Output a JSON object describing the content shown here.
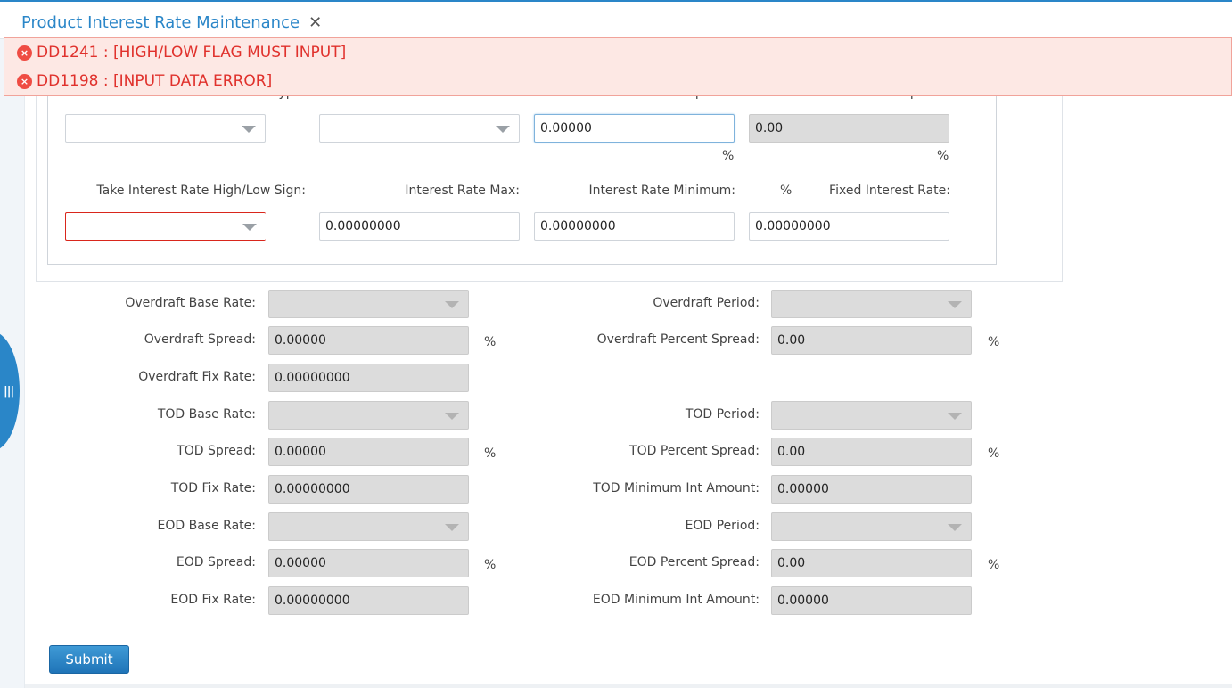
{
  "tab": {
    "title": "Product Interest Rate Maintenance",
    "close": "✕"
  },
  "errors": [
    {
      "text": "DD1241 : [HIGH/LOW FLAG MUST INPUT]"
    },
    {
      "text": "DD1198 : [INPUT DATA ERROR]"
    }
  ],
  "rate_section": {
    "labels_row1": [
      "Interest Rate Type:",
      "Term:",
      "Unit Spread:",
      "Percent Spread:"
    ],
    "row1": {
      "interest_rate_type": "",
      "term": "",
      "unit_spread": "0.00000",
      "percent_spread": "0.00"
    },
    "pct": "%",
    "labels_row2": {
      "high_low_sign": "Take Interest Rate High/Low Sign:",
      "rate_max": "Interest Rate Max:",
      "rate_min": "Interest Rate Minimum:",
      "pct": "%",
      "fixed_rate": "Fixed Interest Rate:"
    },
    "row2": {
      "high_low_sign": "",
      "rate_max": "0.00000000",
      "rate_min": "0.00000000",
      "fixed_rate": "0.00000000"
    }
  },
  "overdraft": {
    "base_rate_label": "Overdraft Base Rate:",
    "period_label": "Overdraft Period:",
    "spread_label": "Overdraft Spread:",
    "spread": "0.00000",
    "percent_spread_label": "Overdraft Percent Spread:",
    "percent_spread": "0.00",
    "fix_rate_label": "Overdraft Fix Rate:",
    "fix_rate": "0.00000000"
  },
  "tod": {
    "base_rate_label": "TOD Base Rate:",
    "period_label": "TOD Period:",
    "spread_label": "TOD Spread:",
    "spread": "0.00000",
    "percent_spread_label": "TOD Percent Spread:",
    "percent_spread": "0.00",
    "fix_rate_label": "TOD Fix Rate:",
    "fix_rate": "0.00000000",
    "min_int_label": "TOD Minimum Int Amount:",
    "min_int": "0.00000"
  },
  "eod": {
    "base_rate_label": "EOD Base Rate:",
    "period_label": "EOD Period:",
    "spread_label": "EOD Spread:",
    "spread": "0.00000",
    "percent_spread_label": "EOD Percent Spread:",
    "percent_spread": "0.00",
    "fix_rate_label": "EOD Fix Rate:",
    "fix_rate": "0.00000000",
    "min_int_label": "EOD Minimum Int Amount:",
    "min_int": "0.00000"
  },
  "pct": "%",
  "submit_label": "Submit",
  "side_handle_icon": "|||",
  "colors": {
    "accent": "#2a86c8",
    "error": "#e0312c",
    "error_bg": "#fde8e4"
  }
}
